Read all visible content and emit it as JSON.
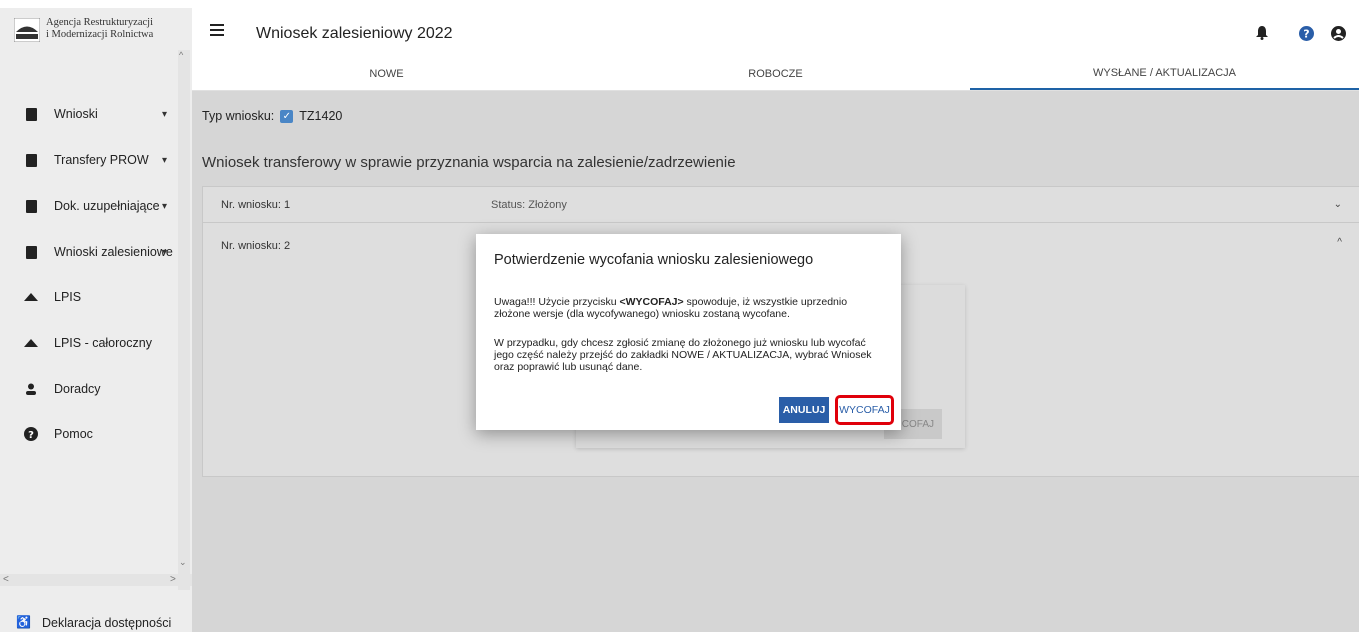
{
  "sidebar": {
    "logo_line1": "Agencja Restrukturyzacji",
    "logo_line2": "i Modernizacji Rolnictwa",
    "items": [
      {
        "label": "Wnioski",
        "icon": "clipboard-icon",
        "has_chevron": true
      },
      {
        "label": "Transfery PROW",
        "icon": "clipboard-icon",
        "has_chevron": true
      },
      {
        "label": "Dok. uzupełniające",
        "icon": "clipboard-icon",
        "has_chevron": true
      },
      {
        "label": "Wnioski zalesieniowe",
        "icon": "clipboard-icon",
        "has_chevron": true
      },
      {
        "label": "LPIS",
        "icon": "mountain-icon",
        "has_chevron": false
      },
      {
        "label": "LPIS - całoroczny",
        "icon": "mountain-icon",
        "has_chevron": false
      },
      {
        "label": "Doradcy",
        "icon": "person-icon",
        "has_chevron": false
      },
      {
        "label": "Pomoc",
        "icon": "help-icon",
        "has_chevron": false
      }
    ],
    "footer_label": "Deklaracja dostępności"
  },
  "header": {
    "title": "Wniosek zalesieniowy 2022"
  },
  "tabs": [
    {
      "label": "NOWE",
      "active": false
    },
    {
      "label": "ROBOCZE",
      "active": false
    },
    {
      "label": "WYSŁANE / AKTUALIZACJA",
      "active": true
    }
  ],
  "main": {
    "typ_label": "Typ wniosku:",
    "typ_value": "TZ1420",
    "heading": "Wniosek transferowy w sprawie przyznania wsparcia na zalesienie/zadrzewienie",
    "panels": [
      {
        "nr": "Nr. wniosku: 1",
        "status": "Status: Złożony"
      },
      {
        "nr": "Nr. wniosku: 2",
        "status": ""
      }
    ],
    "inner_button": "COFAJ"
  },
  "modal": {
    "title": "Potwierdzenie wycofania wniosku zalesieniowego",
    "p1_prefix": "Uwaga!!! Użycie przycisku ",
    "p1_bold": "<WYCOFAJ>",
    "p1_suffix": " spowoduje, iż wszystkie uprzednio złożone wersje (dla wycofywanego) wniosku zostaną wycofane.",
    "p2": "W przypadku, gdy chcesz zgłosić zmianę do złożonego już wniosku lub wycofać jego część należy przejść do zakładki NOWE / AKTUALIZACJA, wybrać Wniosek oraz poprawić lub usunąć dane.",
    "cancel_label": "ANULUJ",
    "confirm_label": "WYCOFAJ"
  },
  "colors": {
    "accent": "#2a5ea8",
    "highlight": "#e0000a",
    "overlay": "#d6d6d6",
    "sidebar": "#ededed"
  }
}
